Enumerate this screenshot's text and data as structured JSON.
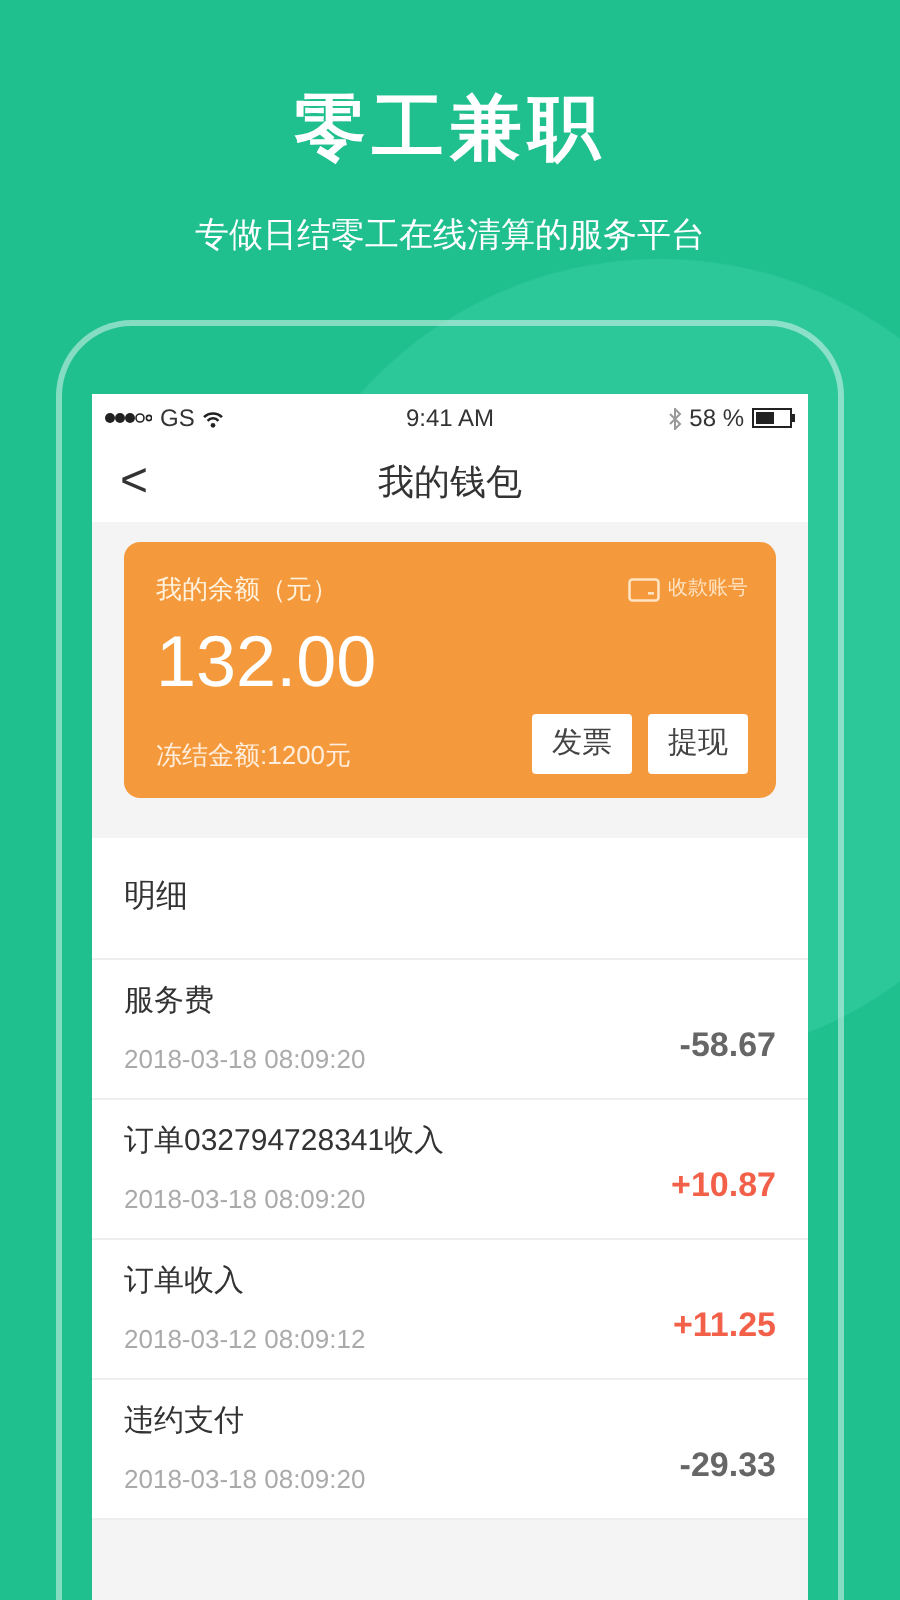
{
  "promo": {
    "title": "零工兼职",
    "subtitle": "专做日结零工在线清算的服务平台"
  },
  "status_bar": {
    "carrier": "GS",
    "time": "9:41 AM",
    "battery": "58 %"
  },
  "nav": {
    "back": "<",
    "title": "我的钱包"
  },
  "wallet": {
    "balance_label": "我的余额（元）",
    "account_link": "收款账号",
    "balance": "132.00",
    "frozen": "冻结金额:1200元",
    "buttons": [
      "发票",
      "提现"
    ]
  },
  "details": {
    "heading": "明细",
    "rows": [
      {
        "title": "服务费",
        "time": "2018-03-18 08:09:20",
        "amount": "-58.67",
        "kind": "expense"
      },
      {
        "title": "订单032794728341收入",
        "time": "2018-03-18 08:09:20",
        "amount": "+10.87",
        "kind": "income"
      },
      {
        "title": "订单收入",
        "time": "2018-03-12 08:09:12",
        "amount": "+11.25",
        "kind": "income"
      },
      {
        "title": "违约支付",
        "time": "2018-03-18 08:09:20",
        "amount": "-29.33",
        "kind": "expense"
      }
    ]
  }
}
